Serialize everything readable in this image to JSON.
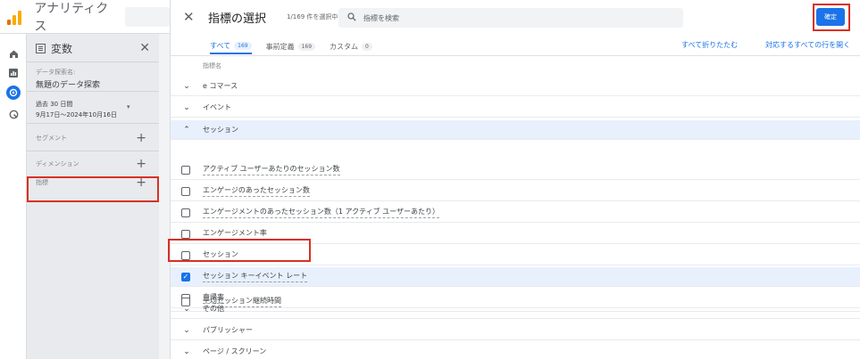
{
  "app": {
    "title": "アナリティクス"
  },
  "variables": {
    "title": "変数",
    "exploration_name_label": "データ探索名:",
    "exploration_name": "無題のデータ探索",
    "date_label": "過去 30 日間",
    "date_range": "9月17日～2024年10月16日",
    "segment_label": "セグメント",
    "dimension_label": "ディメンション",
    "metric_label": "指標",
    "plus": "+",
    "close": "✕"
  },
  "dialog": {
    "close": "✕",
    "title": "指標の選択",
    "count": "1/169 件を選択中",
    "search_placeholder": "指標を検索",
    "confirm_label": "確定",
    "tabs": [
      {
        "label": "すべて",
        "count": "169"
      },
      {
        "label": "事前定義",
        "count": "169"
      },
      {
        "label": "カスタム",
        "count": "0"
      }
    ],
    "collapse_all": "すべて折りたたむ",
    "open_all": "対応するすべての行を開く",
    "column_header": "指標名",
    "categories": [
      {
        "label": "e コマース",
        "chevron": "⌄"
      },
      {
        "label": "イベント",
        "chevron": "⌄"
      },
      {
        "label": "セッション",
        "chevron": "⌃"
      },
      {
        "label": "その他",
        "chevron": "⌄"
      },
      {
        "label": "パブリッシャー",
        "chevron": "⌄"
      },
      {
        "label": "ページ / スクリーン",
        "chevron": "⌄"
      }
    ],
    "metrics": [
      {
        "label": "アクティブ ユーザーあたりのセッション数",
        "checked": false
      },
      {
        "label": "エンゲージのあったセッション数",
        "checked": false
      },
      {
        "label": "エンゲージメントのあったセッション数（1 アクティブ ユーザーあたり）",
        "checked": false
      },
      {
        "label": "エンゲージメント率",
        "checked": false
      },
      {
        "label": "セッション",
        "checked": false
      },
      {
        "label": "セッション キーイベント レート",
        "checked": true
      },
      {
        "label": "直帰率",
        "checked": false
      },
      {
        "label": "平均セッション継続時間",
        "checked": false
      }
    ],
    "check_glyph": "✓"
  },
  "colors": {
    "accent": "#1a73e8",
    "highlight": "#d93025",
    "selected_row": "#e8f0fe"
  }
}
